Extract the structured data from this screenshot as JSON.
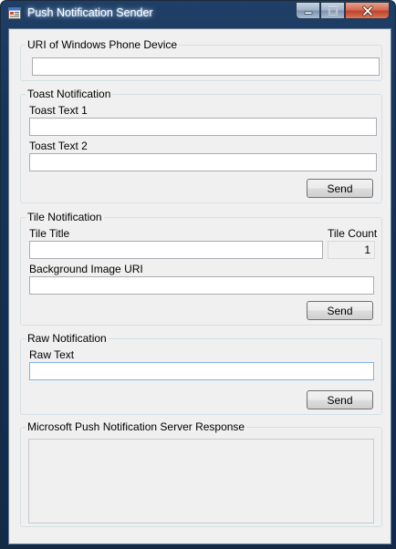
{
  "window": {
    "title": "Push Notification Sender",
    "icon": "app-window-icon"
  },
  "caption_buttons": [
    "minimize-icon",
    "maximize-icon",
    "close-icon"
  ],
  "uri_group": {
    "legend": "URI of Windows Phone Device",
    "value": ""
  },
  "toast": {
    "legend": "Toast Notification",
    "text1_label": "Toast Text 1",
    "text1_value": "",
    "text2_label": "Toast Text 2",
    "text2_value": "",
    "send_label": "Send"
  },
  "tile": {
    "legend": "Tile Notification",
    "title_label": "Tile Title",
    "title_value": "",
    "count_label": "Tile Count",
    "count_value": "1",
    "bg_label": "Background Image URI",
    "bg_value": "",
    "send_label": "Send"
  },
  "raw": {
    "legend": "Raw Notification",
    "text_label": "Raw Text",
    "text_value": "",
    "send_label": "Send"
  },
  "response": {
    "legend": "Microsoft Push Notification Server Response",
    "value": ""
  }
}
